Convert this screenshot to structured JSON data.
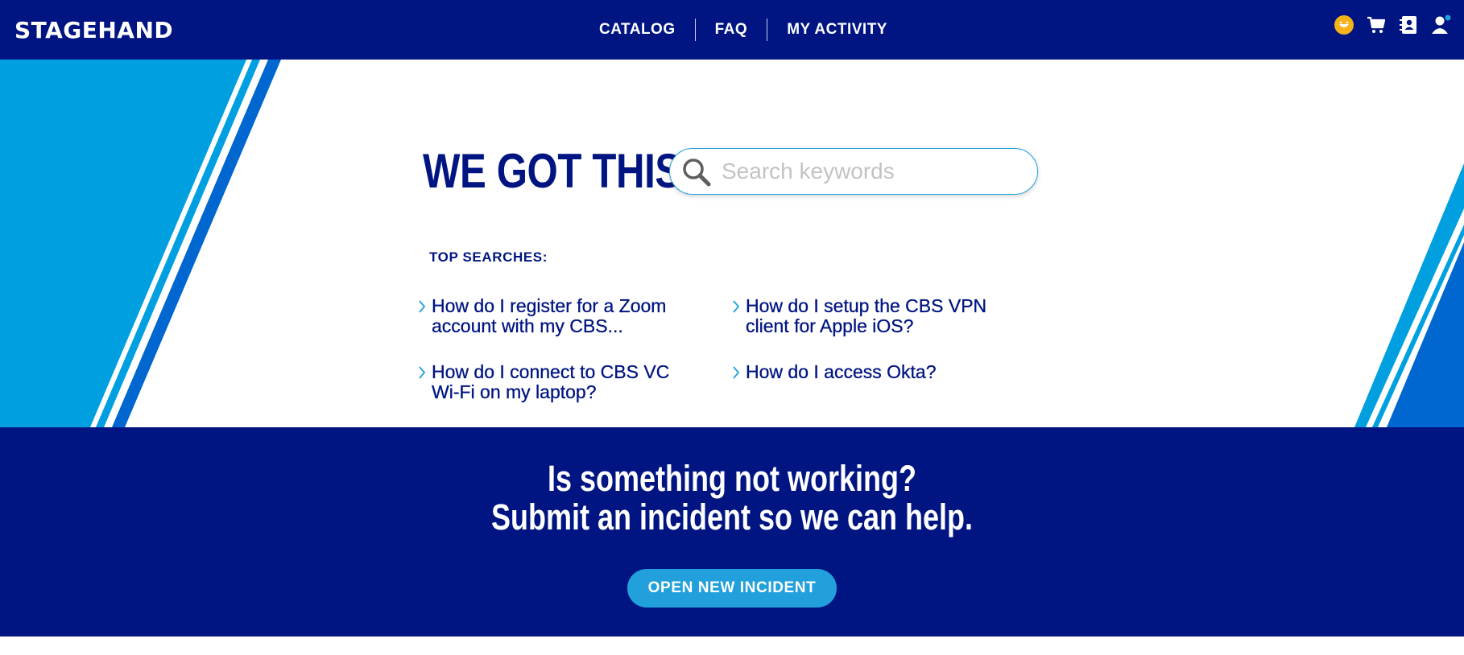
{
  "header": {
    "brand": "STAGEHAND",
    "nav": [
      "CATALOG",
      "FAQ",
      "MY ACTIVITY"
    ],
    "icons": [
      "smiley-face-icon",
      "shopping-cart-icon",
      "contacts-book-icon",
      "user-profile-icon"
    ]
  },
  "hero": {
    "title": "WE GOT THIS",
    "search": {
      "placeholder": "Search keywords",
      "value": ""
    },
    "top_searches_label": "TOP SEARCHES:",
    "top_searches": [
      "How do I register for a Zoom account with my CBS...",
      "How do I setup the CBS VPN client for Apple iOS?",
      "How do I connect to CBS VC Wi-Fi on my laptop?",
      "How do I access Okta?"
    ]
  },
  "incident": {
    "line1": "Is something not working?",
    "line2": "Submit an incident so we can help.",
    "button_label": "OPEN NEW INCIDENT"
  },
  "colors": {
    "navy": "#001581",
    "light_blue": "#00a0e0",
    "mid_blue": "#0066d0",
    "accent": "#21a0dc",
    "smiley": "#f6b21b"
  }
}
